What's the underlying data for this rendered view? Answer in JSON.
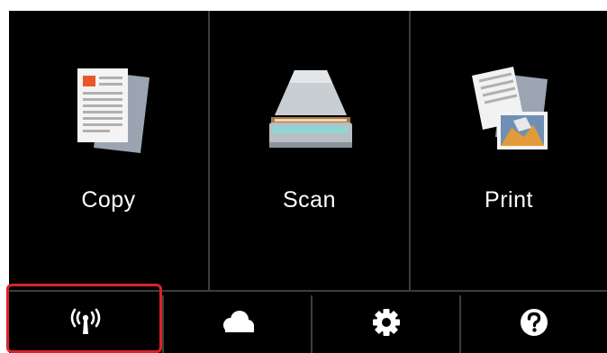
{
  "tiles": [
    {
      "id": "copy",
      "label": "Copy",
      "icon": "copy-document-icon"
    },
    {
      "id": "scan",
      "label": "Scan",
      "icon": "scanner-icon"
    },
    {
      "id": "print",
      "label": "Print",
      "icon": "print-photo-icon"
    }
  ],
  "bottom_bar": [
    {
      "id": "wireless",
      "icon": "wireless-antenna-icon",
      "highlighted": true
    },
    {
      "id": "cloud",
      "icon": "cloud-icon"
    },
    {
      "id": "settings",
      "icon": "gear-icon"
    },
    {
      "id": "help",
      "icon": "question-mark-icon"
    }
  ],
  "colors": {
    "background": "#000000",
    "divider": "#3d3d3d",
    "highlight": "#d7232c",
    "text": "#ffffff"
  }
}
